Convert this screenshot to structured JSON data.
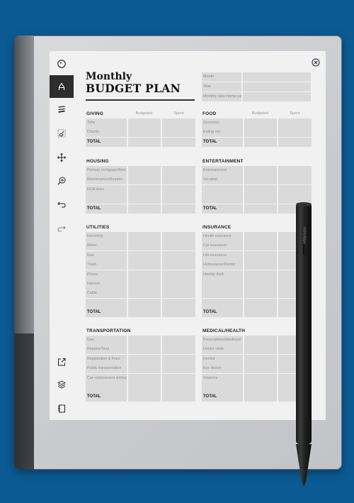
{
  "document": {
    "title_line1": "Monthly",
    "title_line2": "BUDGET PLAN"
  },
  "meta_fields": [
    {
      "label": "Month"
    },
    {
      "label": "Year"
    },
    {
      "label": "Monthly take-home pay"
    }
  ],
  "columns": {
    "budgeted": "Budgeted",
    "spent": "Spent"
  },
  "total_label": "TOTAL",
  "sections": {
    "giving": {
      "title": "GIVING",
      "items": [
        "Tithe",
        "Charity"
      ]
    },
    "food": {
      "title": "FOOD",
      "items": [
        "Groceries",
        "Eating out"
      ]
    },
    "housing": {
      "title": "HOUSING",
      "items": [
        "Primary mortgage/Rent",
        "Maintenance/Repairs",
        "HOA dues",
        ""
      ]
    },
    "entertainment": {
      "title": "ENTERTAINMENT",
      "items": [
        "Entertainment",
        "Vacation",
        "",
        ""
      ]
    },
    "utilities": {
      "title": "UTILITIES",
      "items": [
        "Electricity",
        "Water",
        "Gas",
        "Trash",
        "Phone",
        "Internet",
        "Cable",
        ""
      ]
    },
    "insurance": {
      "title": "INSURANCE",
      "items": [
        "Health insurance",
        "Car insurance",
        "Life insurance",
        "Homeowner/Renter",
        "Identity theft",
        "",
        "",
        ""
      ]
    },
    "transportation": {
      "title": "TRANSPORTATION",
      "items": [
        "Gas",
        "Repairs/Tires",
        "Registration & Fees",
        "Public transportation",
        "Car replacement sinking",
        ""
      ]
    },
    "medical": {
      "title": "MEDICAL/HEALTH",
      "items": [
        "Prescriptions/Medicine",
        "Doctor visits",
        "Dentist",
        "Eye doctor",
        "Vitamins",
        ""
      ]
    }
  },
  "toolbar": {
    "tools": [
      {
        "name": "menu-circle-icon"
      },
      {
        "name": "pen-tool-icon",
        "active": true
      },
      {
        "name": "brush-strokes-icon"
      },
      {
        "name": "eraser-select-icon"
      },
      {
        "name": "move-icon"
      },
      {
        "name": "zoom-in-icon"
      },
      {
        "name": "undo-icon"
      },
      {
        "name": "redo-icon"
      },
      {
        "name": "share-icon"
      },
      {
        "name": "layers-icon"
      },
      {
        "name": "notebook-icon"
      }
    ]
  },
  "pen": {
    "brand": "reMarkable"
  },
  "colors": {
    "background": "#0c5a93",
    "cell": "#dadada",
    "screen": "#f1f1f1",
    "active_tool": "#2d2d2d"
  }
}
